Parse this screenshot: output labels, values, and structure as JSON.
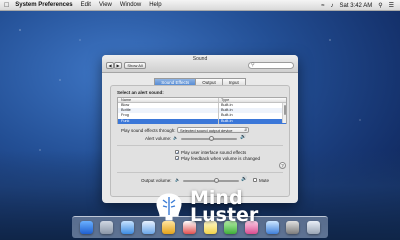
{
  "menubar": {
    "apple_icon": "apple-logo-icon",
    "items": [
      "System Preferences",
      "Edit",
      "View",
      "Window",
      "Help"
    ],
    "clock": "Sat 3:42 AM"
  },
  "window": {
    "title": "Sound",
    "show_all_label": "Show All",
    "back_icon": "chevron-left-icon",
    "forward_icon": "chevron-right-icon",
    "search_placeholder": "",
    "tabs": [
      {
        "label": "Sound Effects",
        "active": true
      },
      {
        "label": "Output",
        "active": false
      },
      {
        "label": "Input",
        "active": false
      }
    ],
    "select_alert_label": "Select an alert sound:",
    "list": {
      "headers": {
        "name": "Name",
        "type": "Type"
      },
      "rows": [
        {
          "name": "Blow",
          "type": "Built-in"
        },
        {
          "name": "Bottle",
          "type": "Built-in"
        },
        {
          "name": "Frog",
          "type": "Built-in"
        },
        {
          "name": "Funk",
          "type": "Built-in"
        }
      ],
      "selected_index": 3
    },
    "play_through_label": "Play sound effects through:",
    "play_through_value": "Selected sound output device",
    "alert_volume_label": "Alert volume:",
    "alert_volume_level": 0.55,
    "ui_effects_label": "Play user interface sound effects",
    "ui_effects_checked": true,
    "feedback_label": "Play feedback when volume is changed",
    "feedback_checked": true,
    "output_volume_label": "Output volume:",
    "output_volume_level": 0.6,
    "mute_label": "Mute",
    "help_label": "?"
  },
  "brand": {
    "line1": "Mind",
    "line2": "Luster"
  }
}
